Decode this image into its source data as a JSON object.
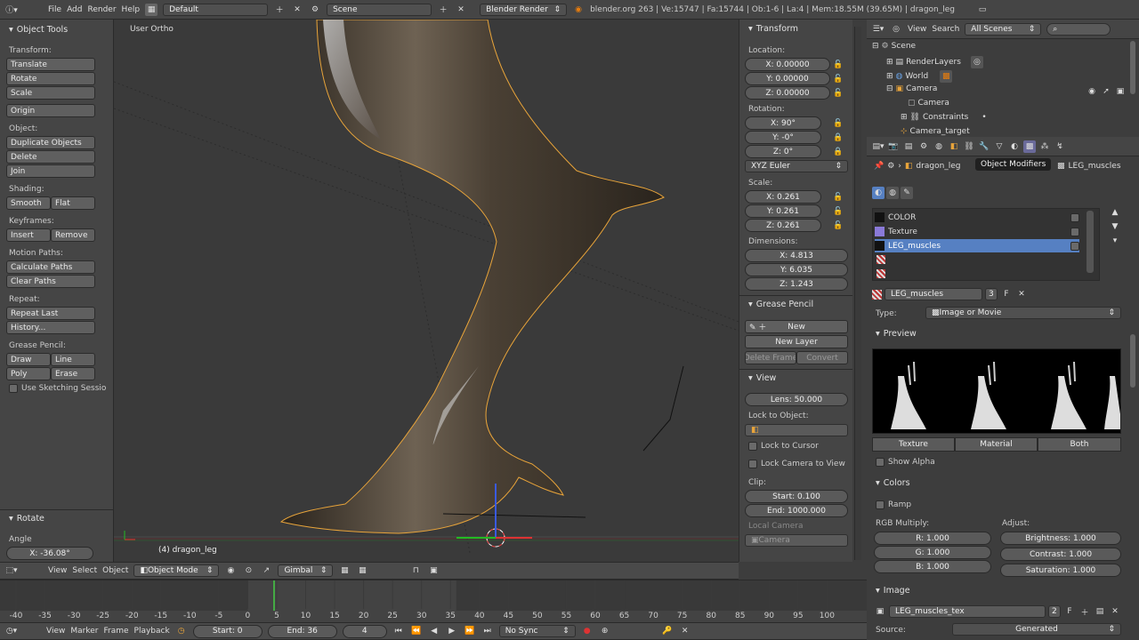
{
  "topbar": {
    "menus": [
      "File",
      "Add",
      "Render",
      "Help"
    ],
    "layout": "Default",
    "scene": "Scene",
    "engine": "Blender Render",
    "stats": "blender.org 263 | Ve:15747 | Fa:15744 | Ob:1-6 | La:4 | Mem:18.55M (39.65M) | dragon_leg"
  },
  "tools": {
    "title": "Object Tools",
    "transform_label": "Transform:",
    "translate": "Translate",
    "rotate": "Rotate",
    "scale": "Scale",
    "origin": "Origin",
    "object_label": "Object:",
    "duplicate": "Duplicate Objects",
    "delete": "Delete",
    "join": "Join",
    "shading_label": "Shading:",
    "smooth": "Smooth",
    "flat": "Flat",
    "keyframes_label": "Keyframes:",
    "insert": "Insert",
    "remove": "Remove",
    "motion_label": "Motion Paths:",
    "calc_paths": "Calculate Paths",
    "clear_paths": "Clear Paths",
    "repeat_label": "Repeat:",
    "repeat_last": "Repeat Last",
    "history": "History...",
    "grease_label": "Grease Pencil:",
    "draw": "Draw",
    "line": "Line",
    "poly": "Poly",
    "erase": "Erase",
    "sketch": "Use Sketching Sessio",
    "op_title": "Rotate",
    "angle_label": "Angle",
    "angle_value": "X: -36.08°"
  },
  "viewport": {
    "view_name": "User Ortho",
    "object_label": "(4) dragon_leg",
    "menus": [
      "View",
      "Select",
      "Object"
    ],
    "mode": "Object Mode",
    "orientation": "Gimbal"
  },
  "npanel": {
    "transform_title": "Transform",
    "location_label": "Location:",
    "loc": [
      "X: 0.00000",
      "Y: 0.00000",
      "Z: 0.00000"
    ],
    "rotation_label": "Rotation:",
    "rot": [
      "X: 90°",
      "Y: -0°",
      "Z: 0°"
    ],
    "rot_mode": "XYZ Euler",
    "scale_label": "Scale:",
    "scale": [
      "X: 0.261",
      "Y: 0.261",
      "Z: 0.261"
    ],
    "dims_label": "Dimensions:",
    "dims": [
      "X: 4.813",
      "Y: 6.035",
      "Z: 1.243"
    ],
    "grease_title": "Grease Pencil",
    "new": "New",
    "new_layer": "New Layer",
    "delete_frame": "Delete Frame",
    "convert": "Convert",
    "view_title": "View",
    "lens": "Lens: 50.000",
    "lock_obj_label": "Lock to Object:",
    "lock_cursor": "Lock to Cursor",
    "lock_camera": "Lock Camera to View",
    "clip_label": "Clip:",
    "clip_start": "Start: 0.100",
    "clip_end": "End: 1000.000",
    "local_camera_label": "Local Camera",
    "local_camera": "Camera"
  },
  "outliner": {
    "menus": [
      "View",
      "Search"
    ],
    "filter": "All Scenes",
    "items": [
      "Scene",
      "RenderLayers",
      "World",
      "Camera",
      "Camera",
      "Constraints",
      "Camera_target"
    ]
  },
  "properties": {
    "tooltip": "Object Modifiers",
    "breadcrumb_obj": "dragon_leg",
    "breadcrumb_tex": "LEG_muscles",
    "slots": [
      "COLOR",
      "Texture",
      "LEG_muscles"
    ],
    "tex_name": "LEG_muscles",
    "tex_users": "3",
    "type_label": "Type:",
    "type_value": "Image or Movie",
    "preview_title": "Preview",
    "tab_texture": "Texture",
    "tab_material": "Material",
    "tab_both": "Both",
    "show_alpha": "Show Alpha",
    "colors_title": "Colors",
    "ramp": "Ramp",
    "rgb_label": "RGB Multiply:",
    "adjust_label": "Adjust:",
    "r": "R: 1.000",
    "g": "G: 1.000",
    "b": "B: 1.000",
    "brightness": "Brightness: 1.000",
    "contrast": "Contrast: 1.000",
    "saturation": "Saturation: 1.000",
    "image_title": "Image",
    "image_name": "LEG_muscles_tex",
    "image_users": "2",
    "source_label": "Source:",
    "source_value": "Generated"
  },
  "timeline": {
    "ticks": [
      "-40",
      "-35",
      "-30",
      "-25",
      "-20",
      "-15",
      "-10",
      "-5",
      "0",
      "5",
      "10",
      "15",
      "20",
      "25",
      "30",
      "35",
      "40",
      "45",
      "50",
      "55",
      "60",
      "65",
      "70",
      "75",
      "80",
      "85",
      "90",
      "95",
      "100"
    ],
    "menus": [
      "View",
      "Marker",
      "Frame",
      "Playback"
    ],
    "start": "Start: 0",
    "end": "End: 36",
    "current": "4",
    "sync": "No Sync"
  }
}
